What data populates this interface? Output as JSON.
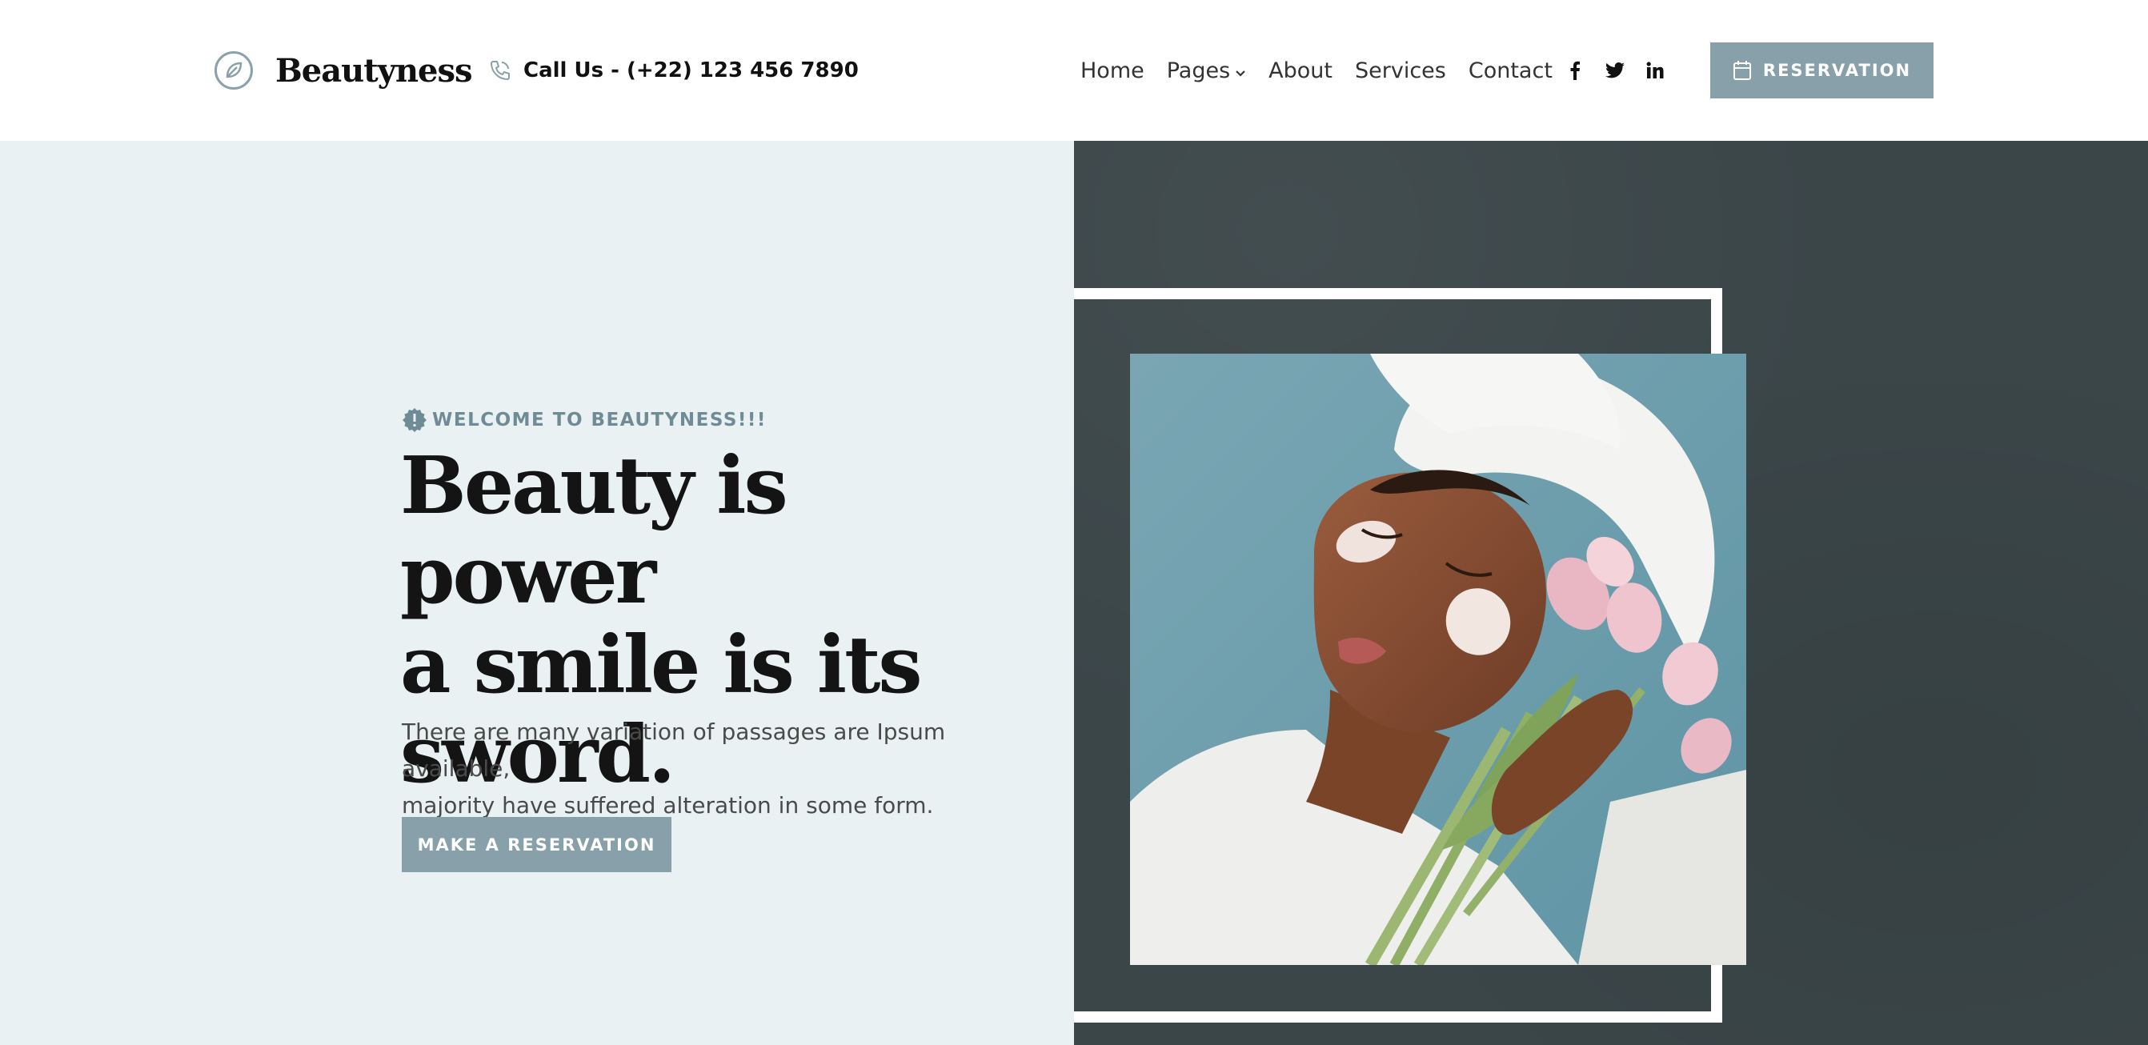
{
  "brand": {
    "name": "Beautyness",
    "logo_icon": "leaf-circle-icon"
  },
  "header": {
    "call_label": "Call Us - (+22) 123 456 7890",
    "call_icon": "phone-icon",
    "nav": [
      {
        "label": "Home"
      },
      {
        "label": "Pages",
        "has_dropdown": true
      },
      {
        "label": "About"
      },
      {
        "label": "Services"
      },
      {
        "label": "Contact"
      }
    ],
    "social": [
      "facebook-icon",
      "twitter-icon",
      "linkedin-icon"
    ],
    "reservation_label": "RESERVATION",
    "reservation_icon": "calendar-icon"
  },
  "hero": {
    "eyebrow": "WELCOME TO BEAUTYNESS!!!",
    "eyebrow_icon": "badge-alert-icon",
    "headline": [
      "Beauty is power",
      "a smile is its",
      "sword."
    ],
    "description": [
      "There are many variation of passages are Ipsum available,",
      "majority have suffered alteration in some form."
    ],
    "cta_label": "MAKE A RESERVATION"
  },
  "colors": {
    "accent": "#88a0a9",
    "hero_left_bg": "#e9f1f2",
    "hero_right_bg": "#3b4649",
    "text_dark": "#141414",
    "eyebrow": "#6f8b95"
  }
}
